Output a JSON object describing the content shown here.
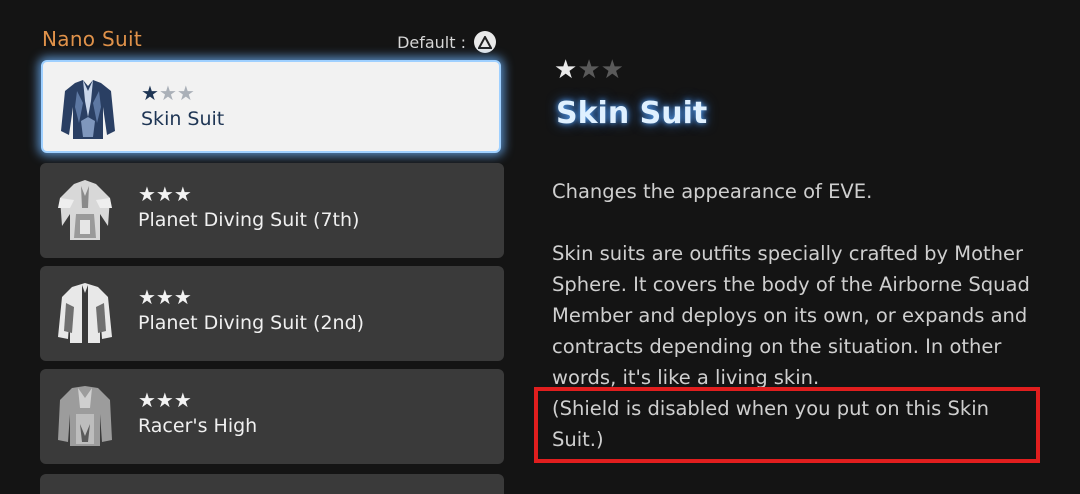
{
  "panel": {
    "title": "Nano Suit",
    "default_label": "Default :",
    "default_button_icon": "triangle-button-icon"
  },
  "items": [
    {
      "stars": 1,
      "max_stars": 3,
      "name": "Skin Suit",
      "selected": true,
      "icon": "skin-suit-icon"
    },
    {
      "stars": 3,
      "max_stars": 3,
      "name": "Planet Diving Suit (7th)",
      "selected": false,
      "icon": "diving-suit-7th-icon"
    },
    {
      "stars": 3,
      "max_stars": 3,
      "name": "Planet Diving Suit (2nd)",
      "selected": false,
      "icon": "diving-suit-2nd-icon"
    },
    {
      "stars": 3,
      "max_stars": 3,
      "name": "Racer's High",
      "selected": false,
      "icon": "racers-high-icon"
    }
  ],
  "detail": {
    "stars": 1,
    "max_stars": 3,
    "title": "Skin Suit",
    "lines_a": [
      "Changes the appearance of EVE."
    ],
    "lines_b": [
      "Skin suits are outfits specially crafted by Mother",
      "Sphere. It covers the body of the Airborne Squad",
      "Member and deploys on its own, or expands and",
      "contracts depending on the situation. In other",
      "words, it's like a living skin.",
      "(Shield is disabled when you put on this Skin",
      "Suit.)"
    ]
  },
  "colors": {
    "accent_orange": "#e0924a",
    "selection_glow": "#6eb4ff",
    "highlight_box": "#e01e1e",
    "background": "#141414"
  }
}
